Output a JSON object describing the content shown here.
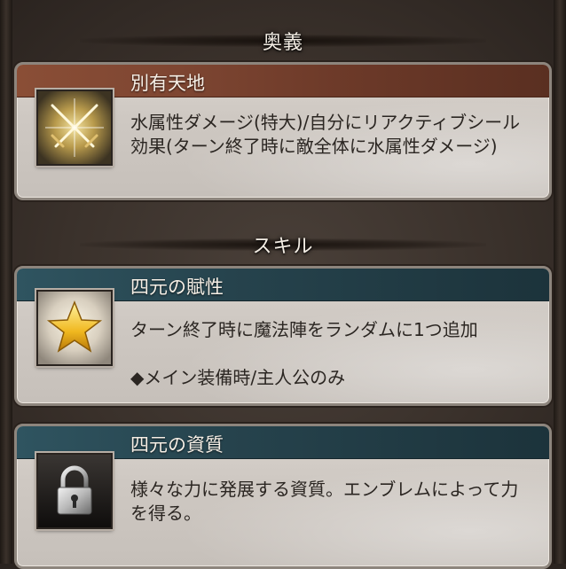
{
  "sections": {
    "ougi_header": "奥義",
    "skill_header": "スキル"
  },
  "ougi": {
    "name": "別有天地",
    "icon": "crossed-swords-icon",
    "description": "水属性ダメージ(特大)/自分にリアクティブシール効果(ターン終了時に敵全体に水属性ダメージ)"
  },
  "skills": [
    {
      "name": "四元の賦性",
      "icon": "star-icon",
      "description": "ターン終了時に魔法陣をランダムに1つ追加",
      "note": "◆メイン装備時/主人公のみ"
    },
    {
      "name": "四元の資質",
      "icon": "lock-icon",
      "description": "様々な力に発展する資質。エンブレムによって力を得る。"
    }
  ],
  "colors": {
    "ougi_title_bar": "#7e4632",
    "skill_title_bar": "#26434d",
    "card_body": "#d3cdc7",
    "background": "#3a312b"
  }
}
